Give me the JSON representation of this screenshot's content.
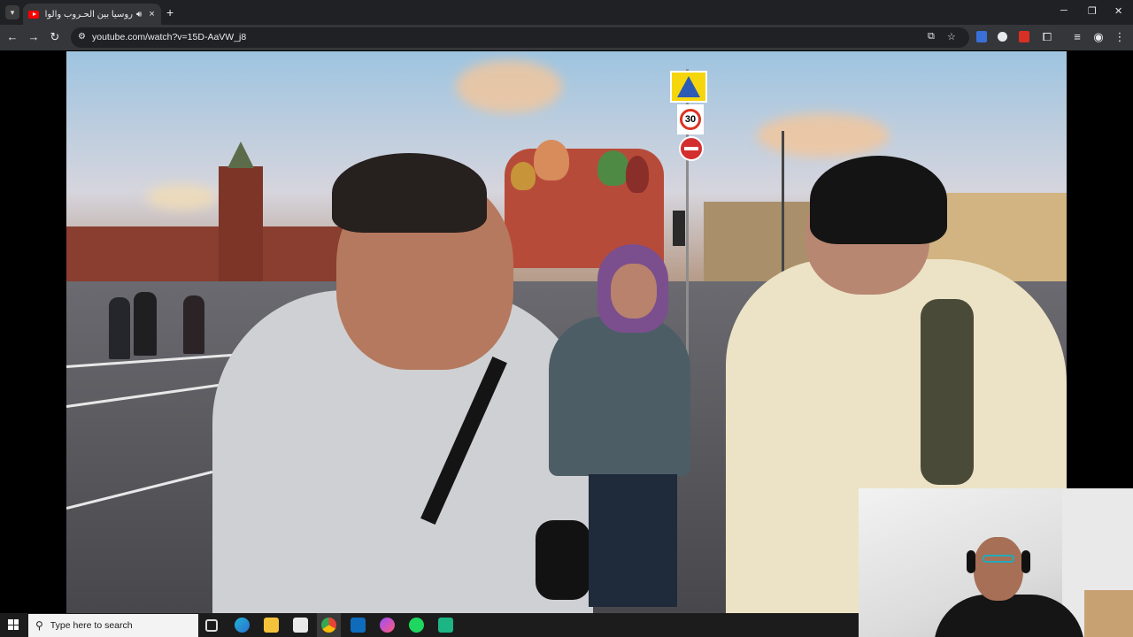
{
  "browser": {
    "tab_title": "روسيا بين الحـروب والواقع |",
    "tab_audio_icon": "speaker-icon",
    "tab_close": "×",
    "new_tab": "+",
    "url": "youtube.com/watch?v=15D-AaVW_j8",
    "window_controls": [
      "─",
      "❐",
      "✕"
    ]
  },
  "video": {
    "sign_speed": "30"
  },
  "taskbar": {
    "search_placeholder": "Type here to search",
    "apps": [
      "task-view",
      "edge",
      "file-explorer",
      "store",
      "chrome",
      "outlook",
      "messenger",
      "spotify",
      "app-green"
    ]
  },
  "colors": {
    "chrome_dark": "#202124",
    "chrome_toolbar": "#35363a",
    "youtube_red": "#ff0000",
    "taskbar": "#1c1c1c"
  }
}
